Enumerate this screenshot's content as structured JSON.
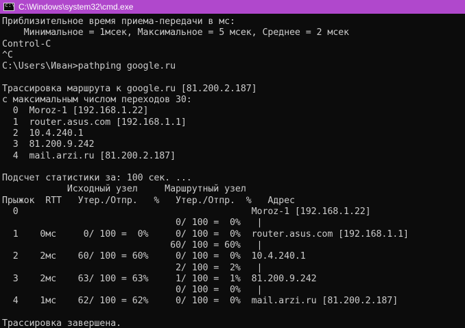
{
  "window": {
    "title": "C:\\Windows\\system32\\cmd.exe",
    "icon": "cmd-console-icon",
    "icon_glyph": "c:\\"
  },
  "console": {
    "lines": [
      "Приблизительное время приема-передачи в мс:",
      "    Минимальное = 1мсек, Максимальное = 5 мсек, Среднее = 2 мсек",
      "Control-C",
      "^C",
      "C:\\Users\\Иван>pathping google.ru",
      "",
      "Трассировка маршрута к google.ru [81.200.2.187]",
      "с максимальным числом переходов 30:",
      "  0  Moroz-1 [192.168.1.22]",
      "  1  router.asus.com [192.168.1.1]",
      "  2  10.4.240.1",
      "  3  81.200.9.242",
      "  4  mail.arzi.ru [81.200.2.187]",
      "",
      "Подсчет статистики за: 100 сек. ...",
      "            Исходный узел     Маршрутный узел",
      "Прыжок  RTT   Утер./Отпр.   %   Утер./Отпр.  %   Адрес",
      "  0                                           Moroz-1 [192.168.1.22]",
      "                                0/ 100 =  0%   |",
      "  1    0мс     0/ 100 =  0%     0/ 100 =  0%  router.asus.com [192.168.1.1]",
      "                               60/ 100 = 60%   |",
      "  2    2мс    60/ 100 = 60%     0/ 100 =  0%  10.4.240.1",
      "                                2/ 100 =  2%   |",
      "  3    2мс    63/ 100 = 63%     1/ 100 =  1%  81.200.9.242",
      "                                0/ 100 =  0%   |",
      "  4    1мс    62/ 100 = 62%     0/ 100 =  0%  mail.arzi.ru [81.200.2.187]",
      "",
      "Трассировка завершена."
    ]
  },
  "colors": {
    "titlebar": "#b048cc",
    "console_background": "#0c0c0c",
    "console_text": "#cccccc"
  }
}
